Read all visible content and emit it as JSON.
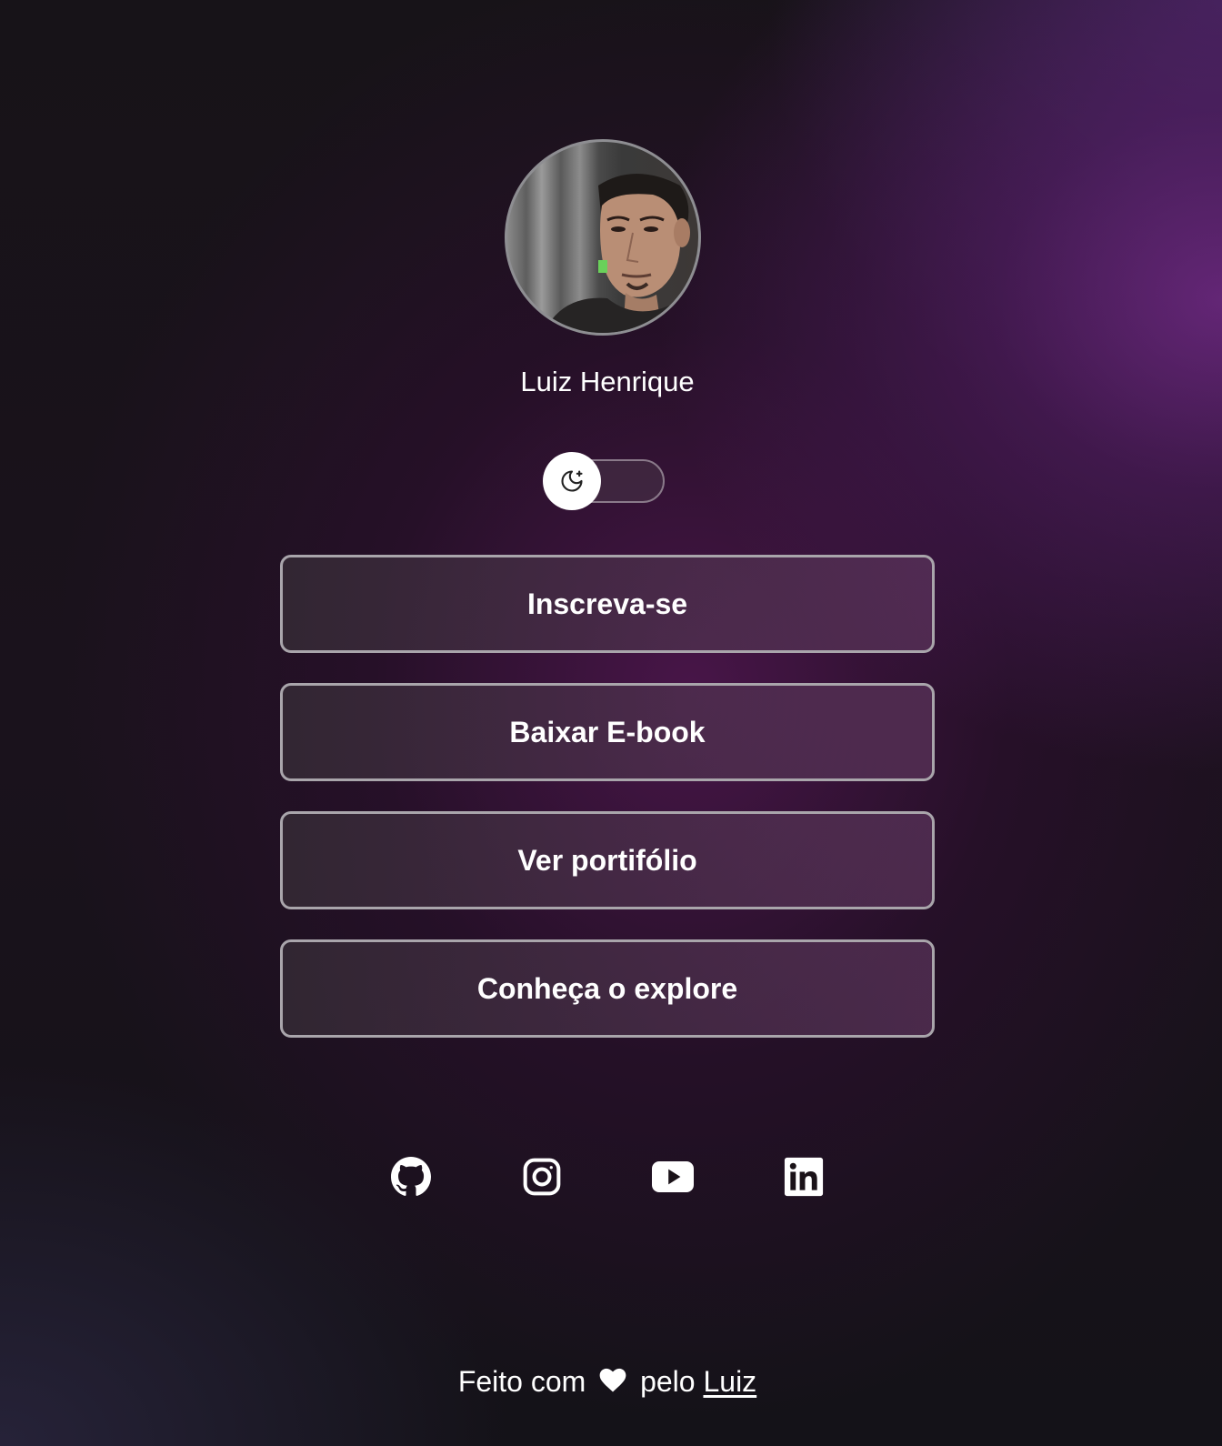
{
  "profile": {
    "name": "Luiz Henrique"
  },
  "theme_toggle": {
    "icon": "moon-stars-icon",
    "state": "dark"
  },
  "links": [
    {
      "label": "Inscreva-se"
    },
    {
      "label": "Baixar E-book"
    },
    {
      "label": "Ver portifólio"
    },
    {
      "label": "Conheça o explore"
    }
  ],
  "social": {
    "icons": [
      "github-icon",
      "instagram-icon",
      "youtube-icon",
      "linkedin-icon"
    ]
  },
  "footer": {
    "prefix": "Feito com",
    "heart_icon": "heart-icon",
    "middle": "pelo",
    "author_link": "Luiz"
  },
  "colors": {
    "button_border": "#a9a5ab",
    "text": "#ffffff",
    "accent_purple": "#6e2882"
  }
}
